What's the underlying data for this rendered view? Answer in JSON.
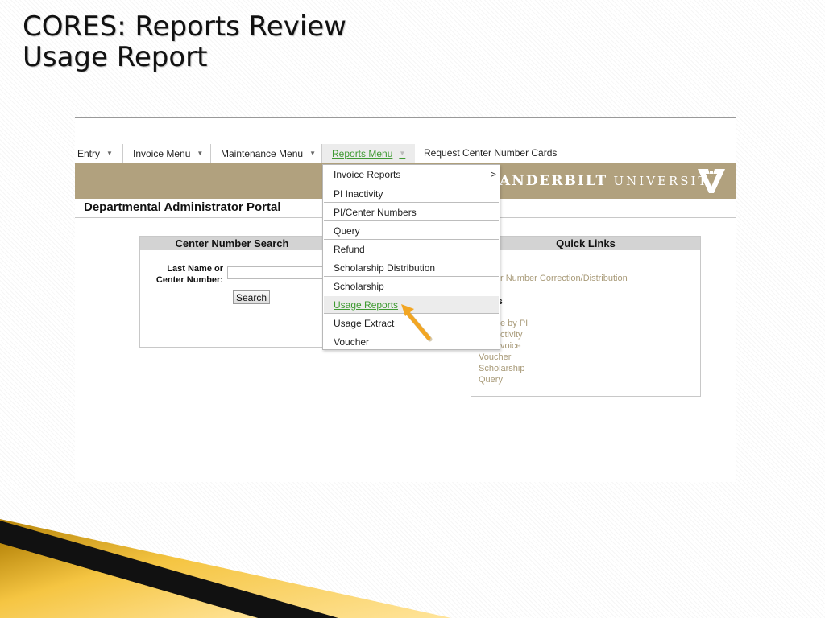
{
  "slide": {
    "title_line1": "CORES: Reports Review",
    "title_line2": "Usage Report"
  },
  "colors": {
    "banner": "#b1a17e",
    "link_green": "#3f9a32",
    "quick_link_gold": "#a89a78",
    "arrow_orange": "#f2a623"
  },
  "menu": {
    "items": [
      {
        "label": "Entry"
      },
      {
        "label": "Invoice Menu"
      },
      {
        "label": "Maintenance Menu"
      },
      {
        "label": "Reports Menu"
      },
      {
        "label": "Request Center Number Cards"
      }
    ],
    "chevron_icon": "chevron-down-icon"
  },
  "banner": {
    "brand_main": "ANDERBILT",
    "brand_sub": "UNIVERSITY",
    "logo_icon": "vanderbilt-v-oak-leaf-icon"
  },
  "portal": {
    "title": "Departmental Administrator Portal"
  },
  "center_search": {
    "heading": "Center Number Search",
    "label_line1": "Last Name or",
    "label_line2": "Center Number:",
    "input_value": "",
    "button_label": "Search"
  },
  "quick_links": {
    "heading": "Quick Links",
    "fragments": {
      "section1": "al",
      "link1": "r Number Correction/Distribution",
      "section2": "ts",
      "link2": "e by PI",
      "link3": "ctivity",
      "link4": "voice",
      "link5": "Voucher",
      "link6": "Scholarship",
      "link7": "Query"
    }
  },
  "reports_dropdown": {
    "items": [
      {
        "label": "Invoice Reports",
        "has_submenu": true,
        "arrow": ">"
      },
      {
        "label": "PI Inactivity"
      },
      {
        "label": "PI/Center Numbers"
      },
      {
        "label": "Query"
      },
      {
        "label": "Refund"
      },
      {
        "label": "Scholarship Distribution"
      },
      {
        "label": "Scholarship"
      },
      {
        "label": "Usage Reports",
        "highlighted": true
      },
      {
        "label": "Usage Extract"
      },
      {
        "label": "Voucher"
      }
    ]
  },
  "annotation": {
    "pointer_icon": "orange-pointer-arrow-icon"
  }
}
